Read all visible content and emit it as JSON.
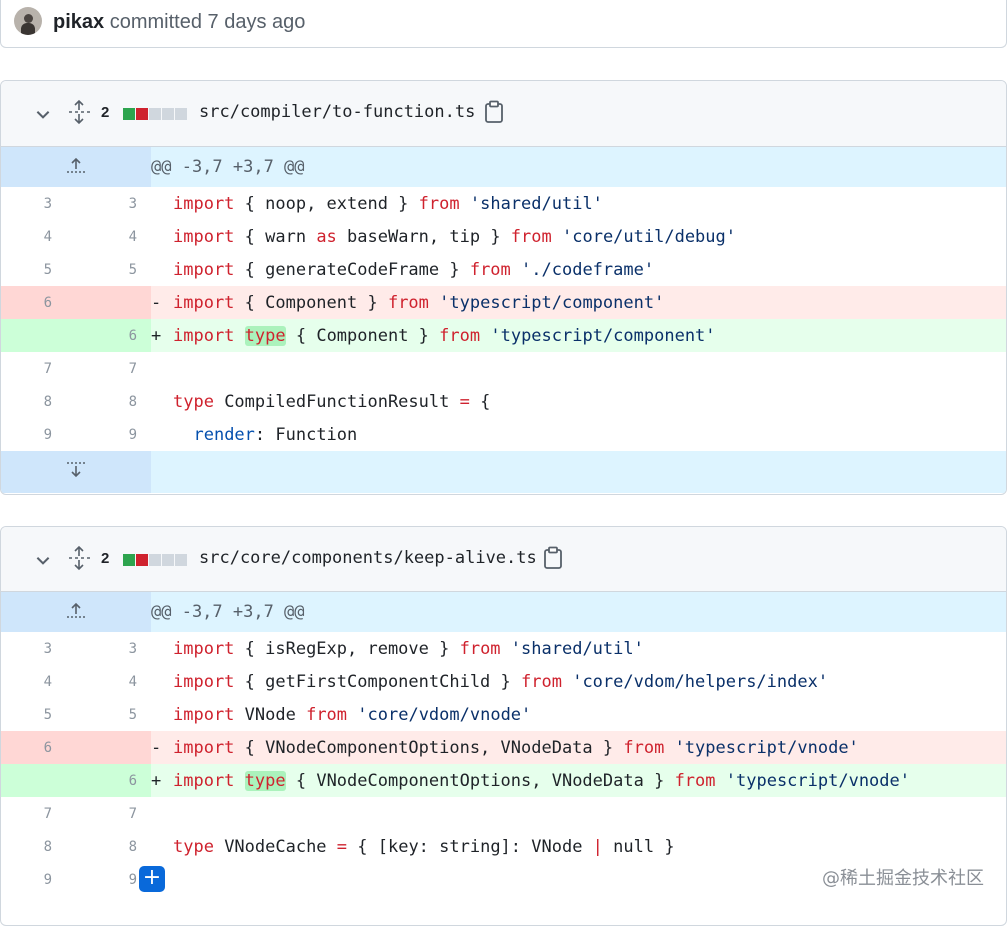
{
  "commit": {
    "author": "pikax",
    "meta": "committed 7 days ago"
  },
  "files": [
    {
      "diff_count": "2",
      "path": "src/compiler/to-function.ts",
      "hunk_header": "@@ -3,7 +3,7 @@"
    },
    {
      "diff_count": "2",
      "path": "src/core/components/keep-alive.ts",
      "hunk_header": "@@ -3,7 +3,7 @@"
    }
  ],
  "lines": {
    "f1": {
      "l3": "3",
      "r3": "3",
      "l4": "4",
      "r4": "4",
      "l5": "5",
      "r5": "5",
      "l6": "6",
      "r6": "6",
      "l7": "7",
      "r7": "7",
      "l8": "8",
      "r8": "8",
      "l9": "9",
      "r9": "9",
      "c3": [
        "import",
        " { noop, extend } ",
        "from",
        " ",
        "'shared/util'"
      ],
      "c4": [
        "import",
        " { warn ",
        "as",
        " baseWarn, tip } ",
        "from",
        " ",
        "'core/util/debug'"
      ],
      "c5": [
        "import",
        " { generateCodeFrame } ",
        "from",
        " ",
        "'./codeframe'"
      ],
      "c6del": [
        "-",
        "import",
        " { Component } ",
        "from",
        " ",
        "'typescript/component'"
      ],
      "c6add": [
        "+",
        "import",
        " ",
        "type",
        " { Component } ",
        "from",
        " ",
        "'typescript/component'"
      ],
      "c8": [
        "type",
        " CompiledFunctionResult ",
        "=",
        " {"
      ],
      "c9": [
        "render",
        ": Function"
      ]
    },
    "f2": {
      "l3": "3",
      "r3": "3",
      "l4": "4",
      "r4": "4",
      "l5": "5",
      "r5": "5",
      "l6": "6",
      "r6": "6",
      "l7": "7",
      "r7": "7",
      "l8": "8",
      "r8": "8",
      "l9": "9",
      "r9": "9",
      "c3": [
        "import",
        " { isRegExp, remove } ",
        "from",
        " ",
        "'shared/util'"
      ],
      "c4": [
        "import",
        " { getFirstComponentChild } ",
        "from",
        " ",
        "'core/vdom/helpers/index'"
      ],
      "c5": [
        "import",
        " VNode ",
        "from",
        " ",
        "'core/vdom/vnode'"
      ],
      "c6del": [
        "-",
        "import",
        " { VNodeComponentOptions, VNodeData } ",
        "from",
        " ",
        "'typescript/vnode'"
      ],
      "c6add": [
        "+",
        "import",
        " ",
        "type",
        " { VNodeComponentOptions, VNodeData } ",
        "from",
        " ",
        "'typescript/vnode'"
      ],
      "c8": [
        "type",
        " VNodeCache ",
        "=",
        " { [key: string]: VNode ",
        "|",
        " null }"
      ]
    }
  },
  "add_comment_label": "+",
  "watermark": "@稀土掘金技术社区",
  "colors": {
    "accent": "#0969da",
    "deletion": "#ffebe9",
    "addition": "#e6ffec",
    "hunk": "#ddf4ff",
    "keyword": "#cf222e",
    "string": "#0a3069"
  }
}
